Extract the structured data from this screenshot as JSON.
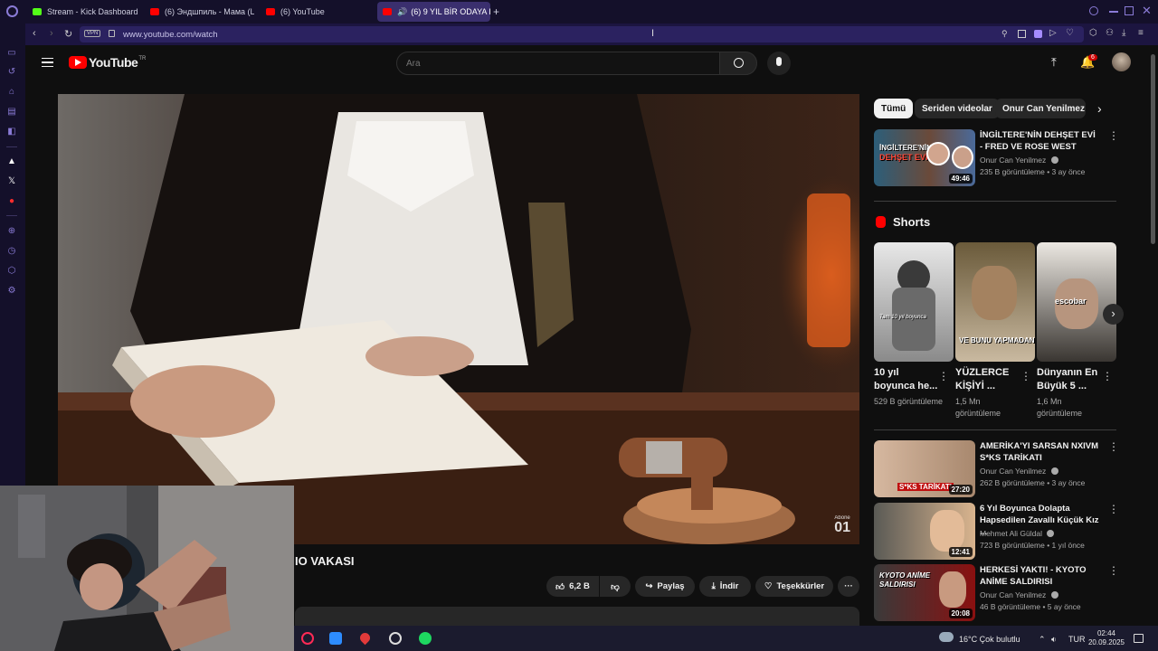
{
  "browser": {
    "tabs": [
      {
        "label": "Stream - Kick Dashboard",
        "color": "#53fc18"
      },
      {
        "label": "(6) Эндшпиль - Мама (L...",
        "color": "#ff0000"
      },
      {
        "label": "(6) YouTube",
        "color": "#ff0000"
      },
      {
        "label": "(6) 9 YIL BİR ODAYA K",
        "color": "#ff0000"
      }
    ],
    "new_tab": "+",
    "url": "www.youtube.com/watch",
    "vpn_badge": "VPN"
  },
  "youtube": {
    "logo_text": "YouTube",
    "logo_region": "TR",
    "search_placeholder": "Ara",
    "notification_count": "6"
  },
  "video": {
    "title_visible": "IO VAKASI",
    "likes": "6,2 B",
    "share_label": "Paylaş",
    "download_label": "İndir",
    "thanks_label": "Teşekkürler",
    "more": "···",
    "watermark_line1": "Abone",
    "watermark_line2": "01"
  },
  "chips": [
    {
      "label": "Tümü",
      "active": true
    },
    {
      "label": "Seriden videolar",
      "active": false
    },
    {
      "label": "Onur Can Yenilmez ad",
      "active": false
    }
  ],
  "recommended_top": {
    "title": "İNGİLTERE'NİN DEHŞET EVİ - FRED VE ROSE WEST",
    "channel": "Onur Can Yenilmez",
    "meta": "235 B görüntüleme • 3 ay önce",
    "duration": "49:46",
    "thumb_text_line1": "İNGİLTERE'NİN",
    "thumb_text_line2": "DEHŞET EVİ"
  },
  "shorts": {
    "heading": "Shorts",
    "items": [
      {
        "title": "10 yıl boyunca he...",
        "views": "529 B görüntüleme",
        "thumb_text": "Tam 10 yıl boyunca"
      },
      {
        "title": "YÜZLERCE KİŞİYİ ...",
        "views": "1,5 Mn görüntüleme",
        "thumb_text": "VE BUNU YAPMADAN"
      },
      {
        "title": "Dünyanın En Büyük 5 ...",
        "views": "1,6 Mn görüntüleme",
        "thumb_text": "escobar"
      }
    ]
  },
  "recommended": [
    {
      "title": "AMERİKA'YI SARSAN NXIVM S*KS TARİKATI",
      "channel": "Onur Can Yenilmez",
      "meta": "262 B görüntüleme • 3 ay önce",
      "duration": "27:20",
      "thumb_text": "S*KS TARİKATI"
    },
    {
      "title": "6 Yıl Boyunca Dolapta Hapsedilen Zavallı Küçük Kız ...",
      "channel": "Mehmet Ali Güldal",
      "meta": "723 B görüntüleme • 1 yıl önce",
      "duration": "12:41",
      "thumb_text": ""
    },
    {
      "title": "HERKESİ YAKTI! - KYOTO ANİME SALDIRISI",
      "channel": "Onur Can Yenilmez",
      "meta": "46 B görüntüleme • 5 ay önce",
      "duration": "20:08",
      "thumb_text": "KYOTO ANİME SALDIRISI"
    }
  ],
  "taskbar": {
    "weather": "16°C  Çok bulutlu",
    "lang": "TUR",
    "time": "02:44",
    "date": "20.09.2025"
  }
}
